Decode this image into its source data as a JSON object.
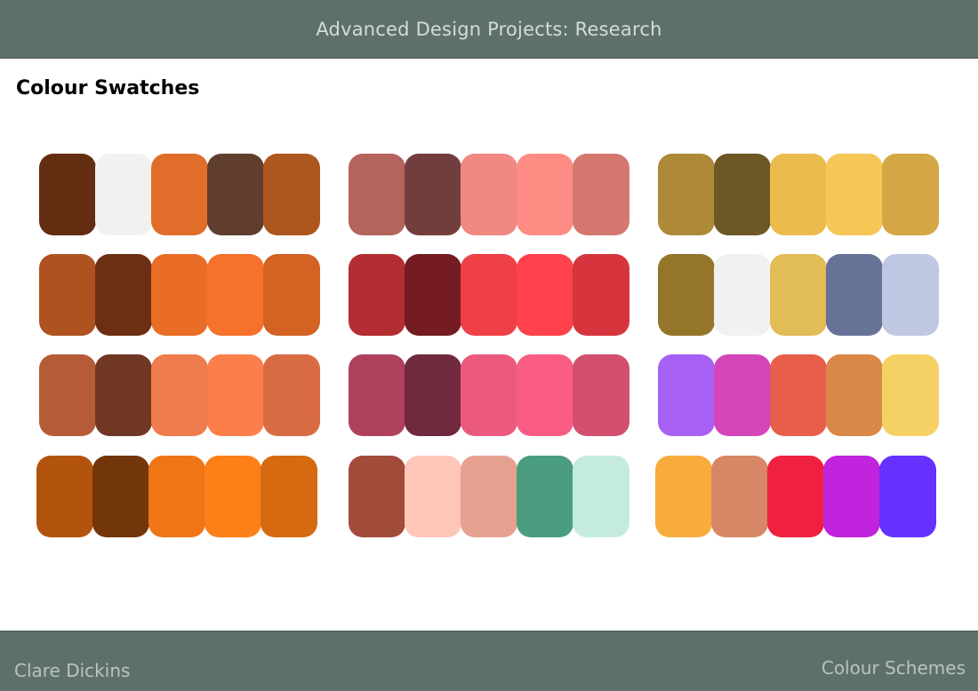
{
  "header": {
    "title": "Advanced Design Projects: Research"
  },
  "page": {
    "heading": "Colour Swatches"
  },
  "footer": {
    "author": "Clare Dickins",
    "section": "Colour Schemes"
  },
  "palettes": [
    [
      "#632d11",
      "#f1f2f0",
      "#e06e2a",
      "#603e2d",
      "#ad561f"
    ],
    [
      "#ae5220",
      "#6d2f14",
      "#ea6d27",
      "#f6712a",
      "#d36223"
    ],
    [
      "#b55b38",
      "#703725",
      "#ef7c4c",
      "#fc7e4b",
      "#d96b43"
    ],
    [
      "#b3540e",
      "#72360a",
      "#f07515",
      "#fc7f17",
      "#d66a10"
    ],
    [
      "#b4635d",
      "#723e3d",
      "#ef8981",
      "#fe8c84",
      "#d57870"
    ],
    [
      "#b32d33",
      "#741c21",
      "#ef3f47",
      "#fe414a",
      "#d6353d"
    ],
    [
      "#af415d",
      "#70293d",
      "#eb5a7c",
      "#f95d84",
      "#d24f6e"
    ],
    [
      "#a14c3b",
      "#fec5b9",
      "#e6a191",
      "#4b9d80",
      "#c5ebdf"
    ],
    [
      "#ae8938",
      "#6c5725",
      "#ecbb4d",
      "#f6c656",
      "#d4a645"
    ],
    [
      "#94752a",
      "#f1f2f0",
      "#e2bc56",
      "#667296",
      "#bfc7e2"
    ],
    [
      "#a661f4",
      "#d545ba",
      "#e85e4b",
      "#d98847",
      "#f5d064"
    ],
    [
      "#f7ac3c",
      "#d78765",
      "#f0213f",
      "#c124dd",
      "#6431ff"
    ]
  ]
}
